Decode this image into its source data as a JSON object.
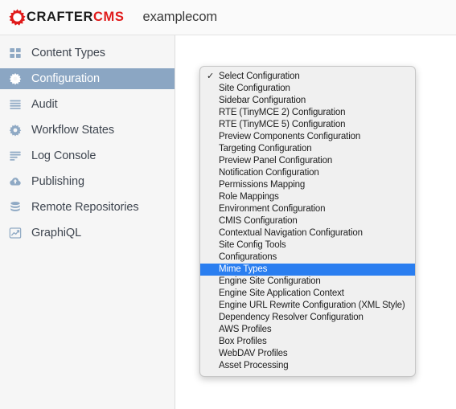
{
  "header": {
    "logo_crafter": "CRAFTER",
    "logo_cms": "CMS",
    "logo_icon": "gear-icon",
    "site_name": "examplecom"
  },
  "sidebar": {
    "items": [
      {
        "label": "Content Types",
        "icon": "grid-icon",
        "active": false
      },
      {
        "label": "Configuration",
        "icon": "gear-icon",
        "active": true
      },
      {
        "label": "Audit",
        "icon": "list-lines-icon",
        "active": false
      },
      {
        "label": "Workflow States",
        "icon": "gear-icon",
        "active": false
      },
      {
        "label": "Log Console",
        "icon": "log-lines-icon",
        "active": false
      },
      {
        "label": "Publishing",
        "icon": "cloud-upload-icon",
        "active": false
      },
      {
        "label": "Remote Repositories",
        "icon": "database-icon",
        "active": false
      },
      {
        "label": "GraphiQL",
        "icon": "chart-line-icon",
        "active": false
      }
    ]
  },
  "dropdown": {
    "checkmark": "✓",
    "selected_index": 16,
    "checked_index": 0,
    "items": [
      {
        "label": "Select Configuration"
      },
      {
        "label": "Site Configuration"
      },
      {
        "label": "Sidebar Configuration"
      },
      {
        "label": "RTE (TinyMCE 2) Configuration"
      },
      {
        "label": "RTE (TinyMCE 5) Configuration"
      },
      {
        "label": "Preview Components Configuration"
      },
      {
        "label": "Targeting Configuration"
      },
      {
        "label": "Preview Panel Configuration"
      },
      {
        "label": "Notification Configuration"
      },
      {
        "label": "Permissions Mapping"
      },
      {
        "label": "Role Mappings"
      },
      {
        "label": "Environment Configuration"
      },
      {
        "label": "CMIS Configuration"
      },
      {
        "label": "Contextual Navigation Configuration"
      },
      {
        "label": "Site Config Tools"
      },
      {
        "label": "Configurations"
      },
      {
        "label": "Mime Types"
      },
      {
        "label": "Engine Site Configuration"
      },
      {
        "label": "Engine Site Application Context"
      },
      {
        "label": "Engine URL Rewrite Configuration (XML Style)"
      },
      {
        "label": "Dependency Resolver Configuration"
      },
      {
        "label": "AWS Profiles"
      },
      {
        "label": "Box Profiles"
      },
      {
        "label": "WebDAV Profiles"
      },
      {
        "label": "Asset Processing"
      }
    ]
  },
  "colors": {
    "brand_red": "#e01b1b",
    "sidebar_active_bg": "#8ba6c3",
    "menu_selected_bg": "#2a7ef0",
    "icon_blue": "#8fa9c4"
  }
}
